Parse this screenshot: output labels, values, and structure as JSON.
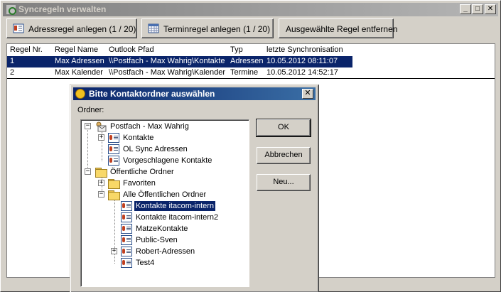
{
  "window": {
    "title": "Syncregeln verwalten",
    "minimize": "_",
    "maximize": "□",
    "close": "✕"
  },
  "toolbar": {
    "add_address_rule": "Adressregel anlegen (1 / 20)",
    "add_calendar_rule": "Terminregel anlegen (1 / 20)",
    "remove_rule": "Ausgewählte Regel entfernen"
  },
  "table": {
    "columns": [
      "Regel Nr.",
      "Regel Name",
      "Outlook Pfad",
      "Typ",
      "letzte Synchronisation"
    ],
    "rows": [
      {
        "nr": "1",
        "name": "Max Adressen",
        "path": "\\\\Postfach - Max Wahrig\\Kontakte",
        "type": "Adressen",
        "last_sync": "10.05.2012 08:11:07"
      },
      {
        "nr": "2",
        "name": "Max Kalender",
        "path": "\\\\Postfach - Max Wahrig\\Kalender",
        "type": "Termine",
        "last_sync": "10.05.2012 14:52:17"
      }
    ]
  },
  "dialog": {
    "title": "Bitte Kontaktordner auswählen",
    "close": "✕",
    "folder_label": "Ordner:",
    "ok": "OK",
    "cancel": "Abbrechen",
    "new": "Neu...",
    "tree": [
      {
        "label": "Postfach - Max Wahrig",
        "icon": "mailbox-icon",
        "expander": "−"
      },
      {
        "label": "Kontakte",
        "icon": "contact-card-icon",
        "expander": "+"
      },
      {
        "label": "OL Sync Adressen",
        "icon": "contact-card-icon"
      },
      {
        "label": "Vorgeschlagene Kontakte",
        "icon": "contact-card-icon"
      },
      {
        "label": "Öffentliche Ordner",
        "icon": "public-folder-icon",
        "expander": "−"
      },
      {
        "label": "Favoriten",
        "icon": "folder-icon",
        "expander": "+"
      },
      {
        "label": "Alle Öffentlichen Ordner",
        "icon": "folder-icon",
        "expander": "−"
      },
      {
        "label": "Kontakte itacom-intern",
        "icon": "contact-card-icon",
        "selected": true
      },
      {
        "label": "Kontakte itacom-intern2",
        "icon": "contact-card-icon"
      },
      {
        "label": "MatzeKontakte",
        "icon": "contact-card-icon"
      },
      {
        "label": "Public-Sven",
        "icon": "contact-card-icon"
      },
      {
        "label": "Robert-Adressen",
        "icon": "contact-card-icon",
        "expander": "+"
      },
      {
        "label": "Test4",
        "icon": "contact-card-icon"
      }
    ]
  }
}
